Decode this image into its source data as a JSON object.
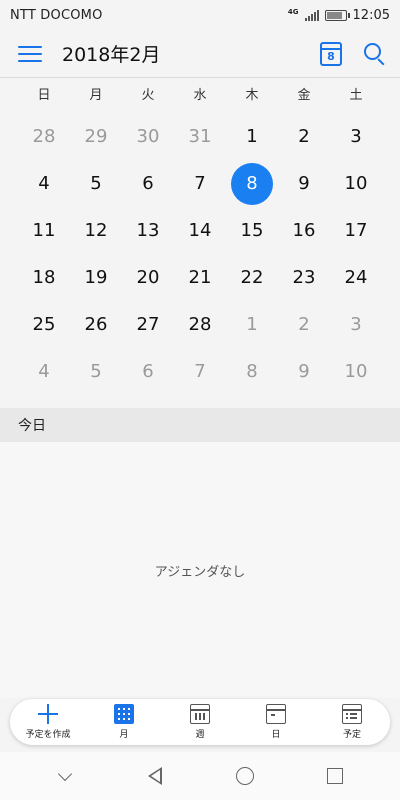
{
  "status_bar": {
    "carrier": "NTT DOCOMO",
    "network": "4G",
    "time": "12:05"
  },
  "header": {
    "title": "2018年2月",
    "today_day": "8"
  },
  "weekdays": [
    "日",
    "月",
    "火",
    "水",
    "木",
    "金",
    "土"
  ],
  "calendar": {
    "today": 8,
    "weeks": [
      [
        {
          "d": "28",
          "m": 1
        },
        {
          "d": "29",
          "m": 1
        },
        {
          "d": "30",
          "m": 1
        },
        {
          "d": "31",
          "m": 1
        },
        {
          "d": "1",
          "m": 0
        },
        {
          "d": "2",
          "m": 0
        },
        {
          "d": "3",
          "m": 0
        }
      ],
      [
        {
          "d": "4",
          "m": 0
        },
        {
          "d": "5",
          "m": 0
        },
        {
          "d": "6",
          "m": 0
        },
        {
          "d": "7",
          "m": 0
        },
        {
          "d": "8",
          "m": 0,
          "t": 1
        },
        {
          "d": "9",
          "m": 0
        },
        {
          "d": "10",
          "m": 0
        }
      ],
      [
        {
          "d": "11",
          "m": 0
        },
        {
          "d": "12",
          "m": 0
        },
        {
          "d": "13",
          "m": 0
        },
        {
          "d": "14",
          "m": 0
        },
        {
          "d": "15",
          "m": 0
        },
        {
          "d": "16",
          "m": 0
        },
        {
          "d": "17",
          "m": 0
        }
      ],
      [
        {
          "d": "18",
          "m": 0
        },
        {
          "d": "19",
          "m": 0
        },
        {
          "d": "20",
          "m": 0
        },
        {
          "d": "21",
          "m": 0
        },
        {
          "d": "22",
          "m": 0
        },
        {
          "d": "23",
          "m": 0
        },
        {
          "d": "24",
          "m": 0
        }
      ],
      [
        {
          "d": "25",
          "m": 0
        },
        {
          "d": "26",
          "m": 0
        },
        {
          "d": "27",
          "m": 0
        },
        {
          "d": "28",
          "m": 0
        },
        {
          "d": "1",
          "m": 1
        },
        {
          "d": "2",
          "m": 1
        },
        {
          "d": "3",
          "m": 1
        }
      ],
      [
        {
          "d": "4",
          "m": 1
        },
        {
          "d": "5",
          "m": 1
        },
        {
          "d": "6",
          "m": 1
        },
        {
          "d": "7",
          "m": 1
        },
        {
          "d": "8",
          "m": 1
        },
        {
          "d": "9",
          "m": 1
        },
        {
          "d": "10",
          "m": 1
        }
      ]
    ]
  },
  "today_section": {
    "label": "今日",
    "empty_text": "アジェンダなし"
  },
  "bottom_nav": {
    "create_label": "予定を作成",
    "month_label": "月",
    "week_label": "週",
    "day_label": "日",
    "schedule_label": "予定"
  },
  "colors": {
    "accent": "#1a73e8",
    "today_circle": "#1a7ff0",
    "muted_text": "#9a9a9a"
  }
}
